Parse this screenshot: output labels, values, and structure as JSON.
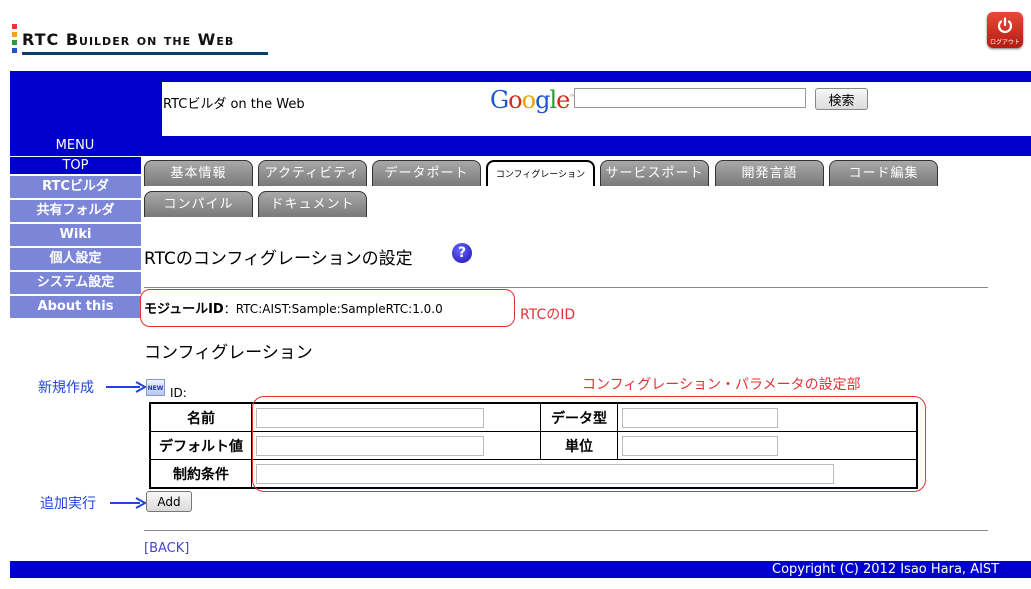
{
  "header": {
    "logo_text": "RTC Builder on the Web",
    "logout_label": "ログアウト"
  },
  "search_bar": {
    "site_name": "RTCビルダ on the Web",
    "google_text": "Google",
    "search_value": "",
    "search_button": "検索"
  },
  "sidebar": {
    "menu_label": "MENU",
    "items": [
      "TOP",
      "RTCビルダ",
      "共有フォルダ",
      "Wiki",
      "個人設定",
      "システム設定",
      "About this"
    ]
  },
  "tabs": [
    "基本情報",
    "アクティビティ",
    "データポート",
    "コンフィグレーション",
    "サービスポート",
    "開発言語",
    "コード編集",
    "コンパイル",
    "ドキュメント"
  ],
  "main": {
    "page_title": "RTCのコンフィグレーションの設定",
    "help_icon": "?",
    "module_id_label": "モジュールID",
    "module_id_value": "：RTC:AIST:Sample:SampleRTC:1.0.0",
    "config_heading": "コンフィグレーション",
    "new_icon_text": "NEW",
    "id_label": "ID:",
    "table": {
      "name_label": "名前",
      "datatype_label": "データ型",
      "default_label": "デフォルト値",
      "unit_label": "単位",
      "constraint_label": "制約条件",
      "name_value": "",
      "datatype_value": "",
      "default_value": "",
      "unit_value": "",
      "constraint_value": ""
    },
    "add_button": "Add",
    "back_link": "[BACK]"
  },
  "annotations": {
    "rtc_id": "RTCのID",
    "new_create": "新規作成",
    "config_param": "コンフィグレーション・パラメータの設定部",
    "add_execute": "追加実行"
  },
  "footer": {
    "copyright": "Copyright (C) 2012 Isao Hara, AIST"
  },
  "colors": {
    "band_blue": "#0000cc",
    "sidebar_item": "#7b86d9",
    "annotation_red": "#e53131",
    "annotation_blue": "#2244dd"
  }
}
